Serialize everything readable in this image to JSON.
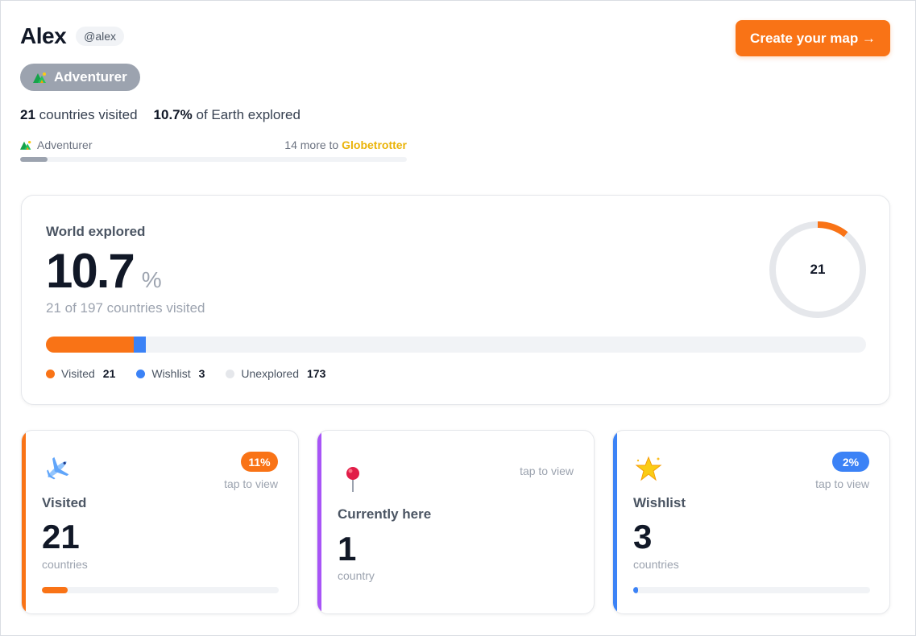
{
  "profile": {
    "name": "Alex",
    "handle": "@alex",
    "rank": "Adventurer",
    "countries_visited": "21",
    "countries_visited_suffix": "countries visited",
    "earth_percent": "10.7%",
    "earth_suffix": "of Earth explored"
  },
  "rank_progress": {
    "current_rank": "Adventurer",
    "remaining_text": "14 more to",
    "next_rank": "Globetrotter",
    "progress_fraction": 0.07
  },
  "cta": {
    "label": "Create your map →"
  },
  "world": {
    "label": "World explored",
    "percent": "10.7",
    "unit": "%",
    "subtitle": "21 of 197 countries visited",
    "donut_center": "21",
    "donut_fraction": 0.107,
    "total": 197,
    "legend": [
      {
        "label": "Visited",
        "value": "21",
        "count": 21,
        "color": "#f97316"
      },
      {
        "label": "Wishlist",
        "value": "3",
        "count": 3,
        "color": "#3b82f6"
      },
      {
        "label": "Unexplored",
        "value": "173",
        "count": 173,
        "color": "#e5e7eb"
      }
    ]
  },
  "cards": [
    {
      "icon": "airplane-icon",
      "accent": "#f97316",
      "badge": "11%",
      "badge_color": "#f97316",
      "tap": "tap to view",
      "title": "Visited",
      "value": "21",
      "unit": "countries",
      "fill_fraction": 0.11
    },
    {
      "icon": "pushpin-icon",
      "accent": "#a855f7",
      "tap": "tap to view",
      "title": "Currently here",
      "value": "1",
      "unit": "country"
    },
    {
      "icon": "star-icon",
      "accent": "#3b82f6",
      "badge": "2%",
      "badge_color": "#3b82f6",
      "tap": "tap to view",
      "title": "Wishlist",
      "value": "3",
      "unit": "countries",
      "fill_fraction": 0.02
    }
  ],
  "colors": {
    "brand": "#f97316",
    "wishlist": "#3b82f6",
    "current": "#a855f7",
    "rank_gray": "#9ca3af",
    "next_rank": "#eab308"
  }
}
